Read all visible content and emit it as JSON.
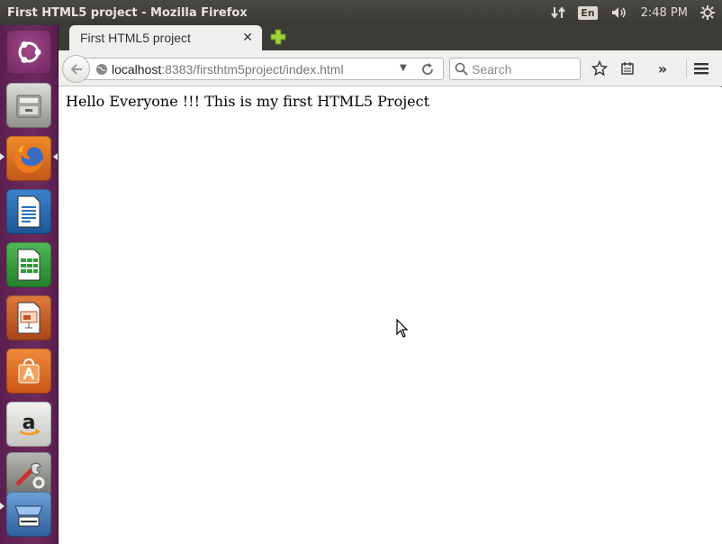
{
  "panel": {
    "window_title": "First HTML5 project - Mozilla Firefox",
    "keyboard_layout": "En",
    "clock": "2:48 PM"
  },
  "launcher": {
    "items": [
      {
        "name": "Ubuntu Dash",
        "icon": "ubuntu-logo-icon",
        "color": "#8e3a73"
      },
      {
        "name": "Files",
        "icon": "file-cabinet-icon",
        "color": "#7a7a76"
      },
      {
        "name": "Firefox",
        "icon": "firefox-icon",
        "color": "#e8711c",
        "running": true
      },
      {
        "name": "LibreOffice Writer",
        "icon": "writer-icon",
        "color": "#2a6fb8"
      },
      {
        "name": "LibreOffice Calc",
        "icon": "calc-icon",
        "color": "#2f9a37"
      },
      {
        "name": "LibreOffice Impress",
        "icon": "impress-icon",
        "color": "#c0521c"
      },
      {
        "name": "Ubuntu Software Center",
        "icon": "shopping-bag-icon",
        "color": "#e46b22"
      },
      {
        "name": "Amazon",
        "icon": "amazon-icon",
        "color": "#d9d9d6"
      },
      {
        "name": "System Settings",
        "icon": "settings-icon",
        "color": "#9a9a96"
      },
      {
        "name": "Workspace Switcher",
        "icon": "workspaces-icon",
        "color": "#4a7fbf"
      }
    ]
  },
  "browser": {
    "tab_title": "First HTML5 project",
    "url_host": "localhost",
    "url_rest": ":8383/firsthtm5project/index.html",
    "search_placeholder": "Search",
    "page_text": "Hello Everyone !!! This is my first HTML5 Project"
  }
}
